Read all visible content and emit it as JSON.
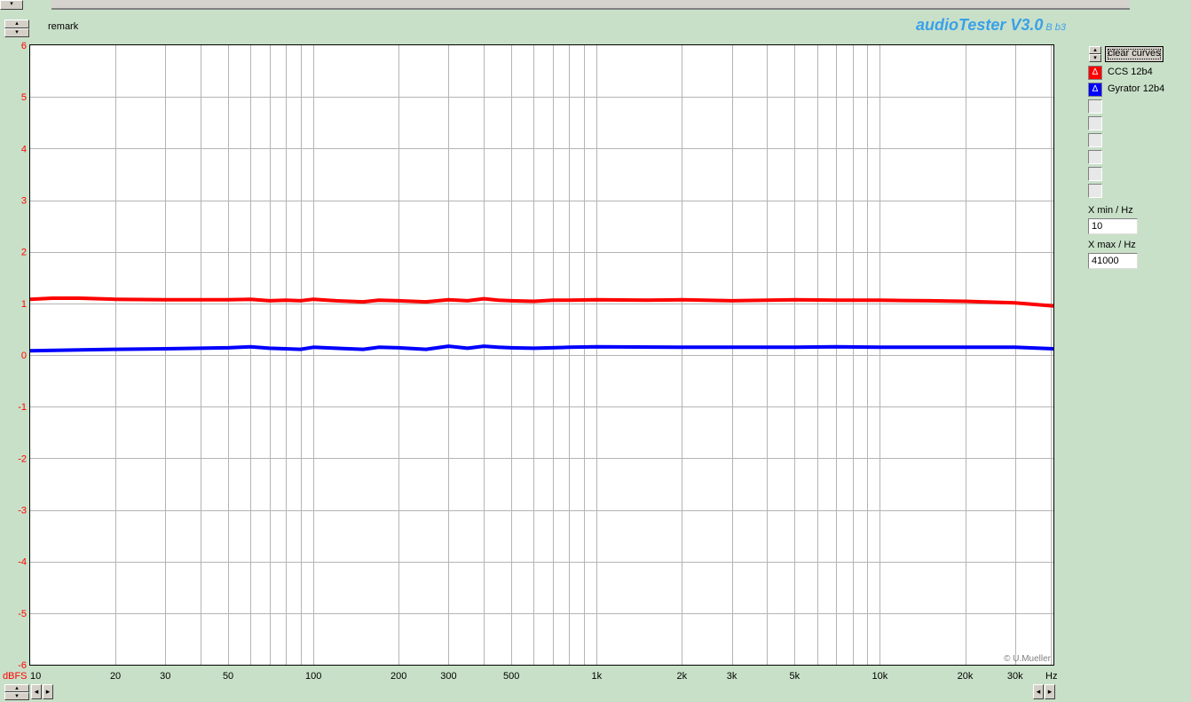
{
  "app": {
    "name": "audioTester V3.0",
    "version_tag": "B b3"
  },
  "header": {
    "remark_label": "remark"
  },
  "panel": {
    "clear_button": "clear curves",
    "curves": [
      {
        "label": "CCS 12b4",
        "color": "#ff0000",
        "marker": "Δ"
      },
      {
        "label": "Gyrator 12b4",
        "color": "#0000ff",
        "marker": "Δ"
      }
    ],
    "empty_slot_count": 6,
    "xmin_label": "X min / Hz",
    "xmin_value": "10",
    "xmax_label": "X max / Hz",
    "xmax_value": "41000"
  },
  "plot": {
    "copyright": "© U.Mueller",
    "y_unit": "dBFS",
    "x_unit": "Hz"
  },
  "chart_data": {
    "type": "line",
    "title": "",
    "xlabel": "Hz",
    "ylabel": "dBFS",
    "xscale": "log",
    "xlim": [
      10,
      41000
    ],
    "ylim": [
      -6,
      6
    ],
    "grid": true,
    "y_ticks": [
      6,
      5,
      4,
      3,
      2,
      1,
      0,
      -1,
      -2,
      -3,
      -4,
      -5,
      -6
    ],
    "x_tick_labels": [
      {
        "value": 10,
        "label": "10"
      },
      {
        "value": 20,
        "label": "20"
      },
      {
        "value": 30,
        "label": "30"
      },
      {
        "value": 50,
        "label": "50"
      },
      {
        "value": 100,
        "label": "100"
      },
      {
        "value": 200,
        "label": "200"
      },
      {
        "value": 300,
        "label": "300"
      },
      {
        "value": 500,
        "label": "500"
      },
      {
        "value": 1000,
        "label": "1k"
      },
      {
        "value": 2000,
        "label": "2k"
      },
      {
        "value": 3000,
        "label": "3k"
      },
      {
        "value": 5000,
        "label": "5k"
      },
      {
        "value": 10000,
        "label": "10k"
      },
      {
        "value": 20000,
        "label": "20k"
      },
      {
        "value": 30000,
        "label": "30k"
      }
    ],
    "series": [
      {
        "name": "CCS 12b4",
        "color": "#ff0000",
        "points": [
          [
            10,
            1.08
          ],
          [
            12,
            1.1
          ],
          [
            15,
            1.1
          ],
          [
            20,
            1.08
          ],
          [
            30,
            1.07
          ],
          [
            50,
            1.07
          ],
          [
            60,
            1.08
          ],
          [
            70,
            1.05
          ],
          [
            80,
            1.06
          ],
          [
            90,
            1.05
          ],
          [
            100,
            1.08
          ],
          [
            120,
            1.05
          ],
          [
            150,
            1.03
          ],
          [
            170,
            1.06
          ],
          [
            200,
            1.05
          ],
          [
            250,
            1.03
          ],
          [
            300,
            1.07
          ],
          [
            350,
            1.05
          ],
          [
            400,
            1.09
          ],
          [
            450,
            1.06
          ],
          [
            500,
            1.05
          ],
          [
            600,
            1.04
          ],
          [
            700,
            1.06
          ],
          [
            800,
            1.06
          ],
          [
            1000,
            1.07
          ],
          [
            1500,
            1.06
          ],
          [
            2000,
            1.07
          ],
          [
            3000,
            1.05
          ],
          [
            5000,
            1.07
          ],
          [
            7000,
            1.06
          ],
          [
            10000,
            1.06
          ],
          [
            15000,
            1.05
          ],
          [
            20000,
            1.04
          ],
          [
            30000,
            1.01
          ],
          [
            41000,
            0.95
          ]
        ]
      },
      {
        "name": "Gyrator 12b4",
        "color": "#0000ff",
        "points": [
          [
            10,
            0.08
          ],
          [
            15,
            0.1
          ],
          [
            20,
            0.11
          ],
          [
            30,
            0.12
          ],
          [
            50,
            0.14
          ],
          [
            60,
            0.16
          ],
          [
            70,
            0.13
          ],
          [
            80,
            0.12
          ],
          [
            90,
            0.11
          ],
          [
            100,
            0.15
          ],
          [
            120,
            0.13
          ],
          [
            150,
            0.11
          ],
          [
            170,
            0.15
          ],
          [
            200,
            0.14
          ],
          [
            250,
            0.11
          ],
          [
            300,
            0.17
          ],
          [
            350,
            0.13
          ],
          [
            400,
            0.17
          ],
          [
            450,
            0.15
          ],
          [
            500,
            0.14
          ],
          [
            600,
            0.13
          ],
          [
            800,
            0.15
          ],
          [
            1000,
            0.16
          ],
          [
            2000,
            0.15
          ],
          [
            3000,
            0.15
          ],
          [
            5000,
            0.15
          ],
          [
            7000,
            0.16
          ],
          [
            10000,
            0.15
          ],
          [
            20000,
            0.15
          ],
          [
            30000,
            0.15
          ],
          [
            41000,
            0.12
          ]
        ]
      }
    ]
  }
}
